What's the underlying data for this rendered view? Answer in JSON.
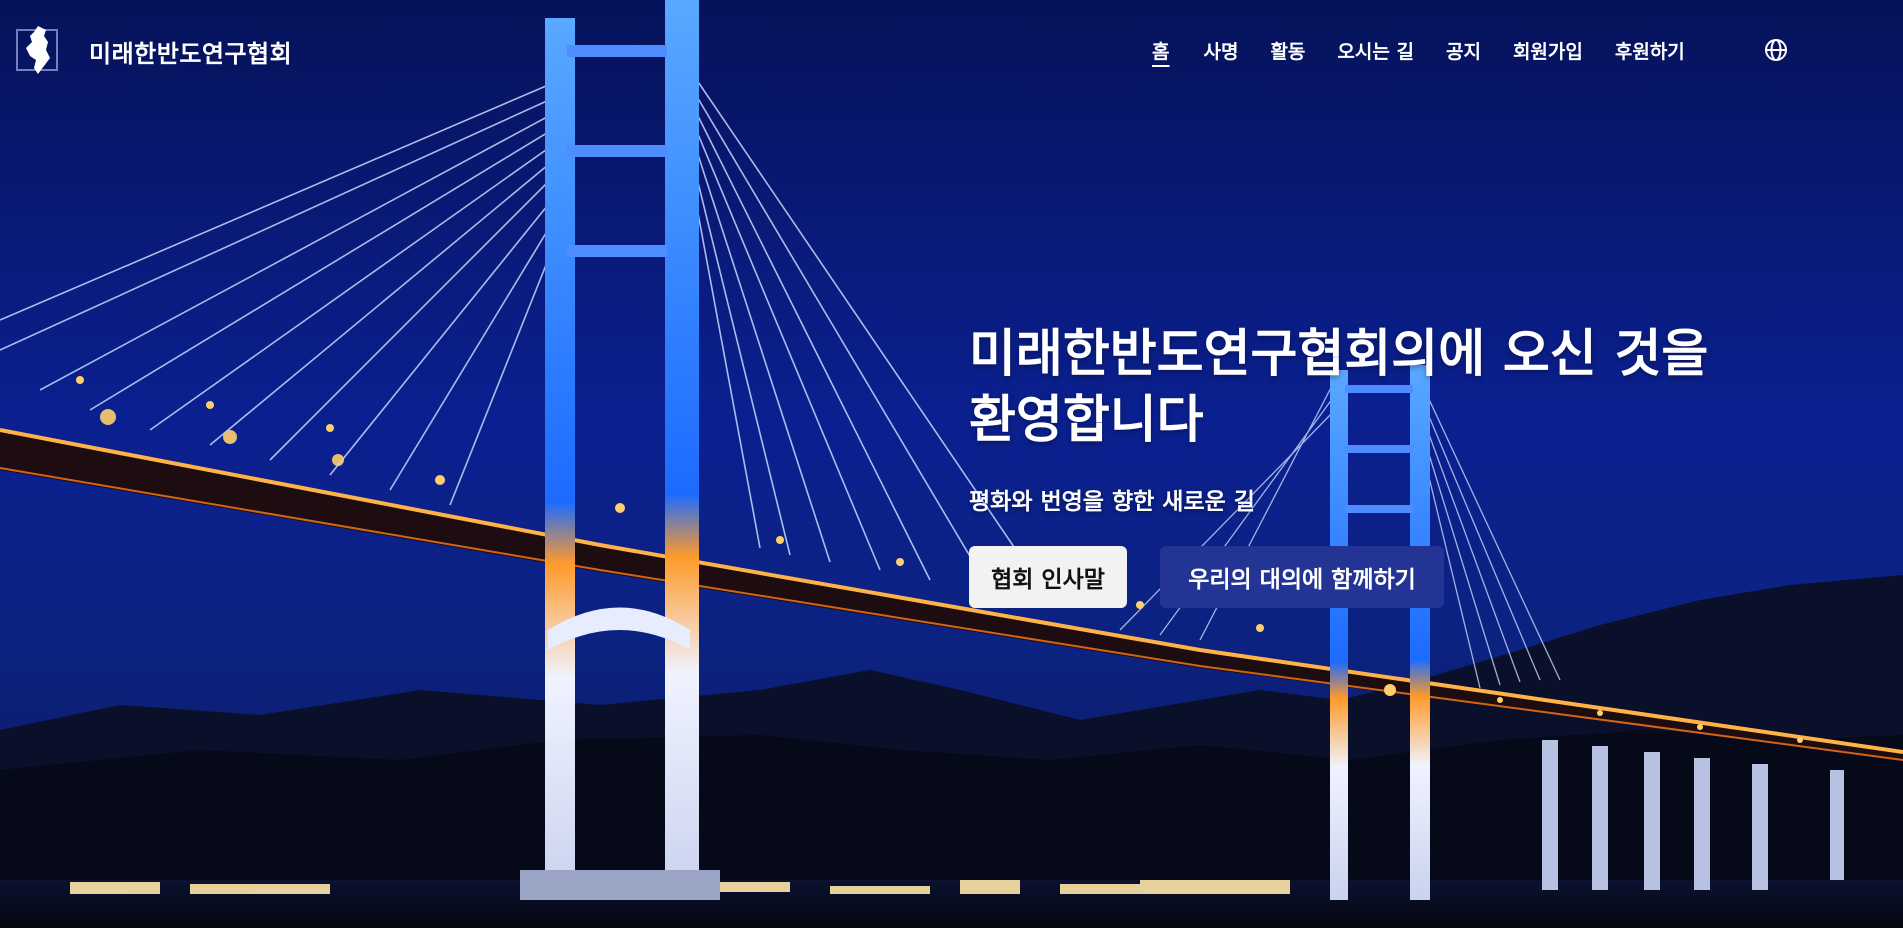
{
  "brand": {
    "name": "미래한반도연구협회",
    "logo_icon": "korea-peninsula-logo-icon"
  },
  "nav": {
    "items": [
      {
        "label": "홈",
        "active": true
      },
      {
        "label": "사명",
        "active": false
      },
      {
        "label": "활동",
        "active": false
      },
      {
        "label": "오시는 길",
        "active": false
      },
      {
        "label": "공지",
        "active": false
      },
      {
        "label": "회원가입",
        "active": false
      },
      {
        "label": "후원하기",
        "active": false
      }
    ],
    "language_icon": "globe-icon"
  },
  "hero": {
    "title_line1": "미래한반도연구협회의에 오신 것을",
    "title_line2": "환영합니다",
    "subtitle": "평화와 번영을 향한 새로운 길",
    "primary_button": "협회 인사말",
    "secondary_button": "우리의 대의에 함께하기"
  },
  "colors": {
    "sky": "#0a1d7d",
    "button_primary": "#233494",
    "button_light": "#f2f2f2",
    "text": "#ffffff"
  }
}
